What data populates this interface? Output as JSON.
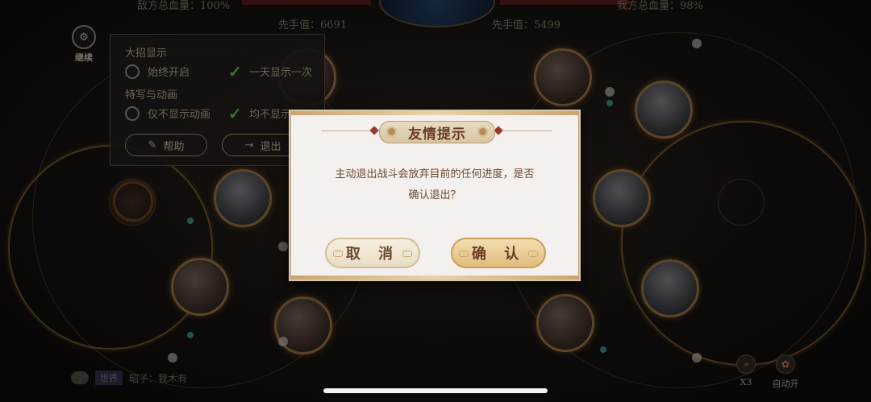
{
  "top": {
    "enemy_total_hp": "敌方总血量：100%",
    "ally_total_hp": "我方总血量：98%",
    "enemy_initiative": "先手值：6691",
    "ally_initiative": "先手值：5499"
  },
  "menu": {
    "continue_label": "继续",
    "section_ultimate": "大招显示",
    "option_always_on": "始终开启",
    "option_once_per_day": "一天显示一次",
    "section_closeup": "特写与动画",
    "option_hide_anim_only": "仅不显示动画",
    "option_hide_all": "均不显示",
    "help_label": "帮助",
    "exit_label": "退出"
  },
  "dialog": {
    "title": "友情提示",
    "message_line1": "主动退出战斗会放弃目前的任何进度，是否",
    "message_line2": "确认退出？",
    "cancel_label": "取 消",
    "confirm_label": "确 认"
  },
  "bottom": {
    "chat_tag": "世界",
    "chat_text": "昭子：我木有",
    "speed_label": "X3",
    "auto_label": "自动开"
  }
}
